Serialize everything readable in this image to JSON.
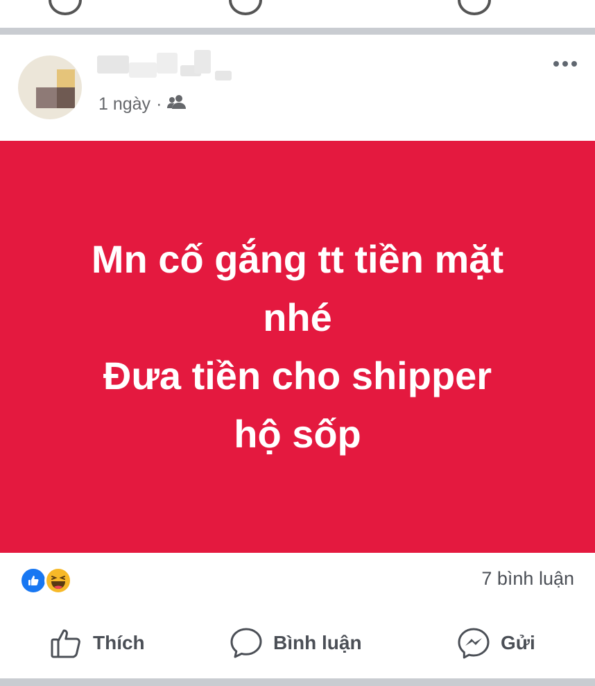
{
  "post": {
    "time": "1 ngày",
    "separator": "·",
    "audience_icon": "friends-icon",
    "menu_icon": "more-icon",
    "background_color": "#e4193f",
    "text_lines": [
      "Mn cố gắng tt tiền mặt",
      "nhé",
      "Đưa tiền cho shipper",
      "hộ sốp"
    ]
  },
  "reactions": {
    "icons": [
      "like-icon",
      "haha-icon"
    ],
    "comment_count": "7 bình luận"
  },
  "actions": {
    "like_label": "Thích",
    "comment_label": "Bình luận",
    "share_label": "Gửi"
  }
}
